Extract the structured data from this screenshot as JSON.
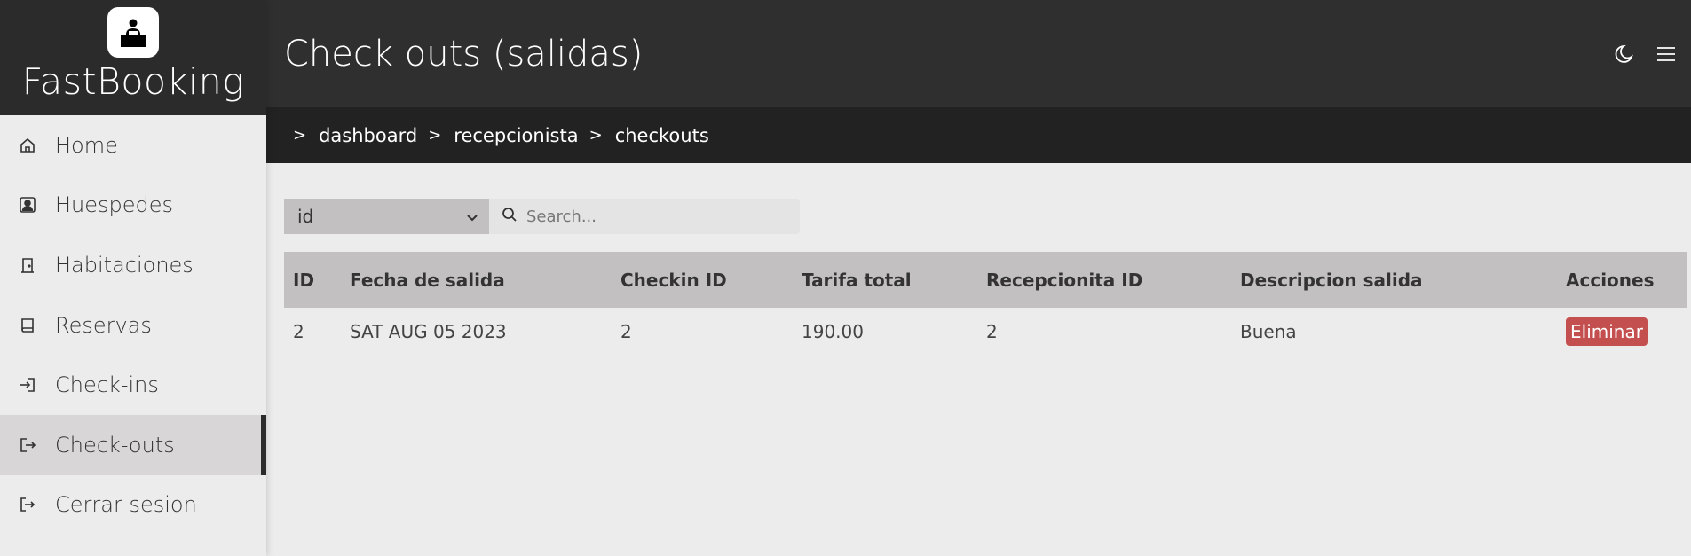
{
  "brand": {
    "name": "FastBooking"
  },
  "sidebar": {
    "items": [
      {
        "label": "Home",
        "icon": "home-icon"
      },
      {
        "label": "Huespedes",
        "icon": "guest-icon"
      },
      {
        "label": "Habitaciones",
        "icon": "door-icon"
      },
      {
        "label": "Reservas",
        "icon": "book-icon"
      },
      {
        "label": "Check-ins",
        "icon": "checkin-icon"
      },
      {
        "label": "Check-outs",
        "icon": "checkout-icon",
        "active": true
      },
      {
        "label": "Cerrar sesion",
        "icon": "logout-icon"
      }
    ]
  },
  "header": {
    "title": "Check outs (salidas)"
  },
  "breadcrumb": [
    "dashboard",
    "recepcionista",
    "checkouts"
  ],
  "filter": {
    "selected": "id",
    "search_placeholder": "Search..."
  },
  "table": {
    "columns": [
      "ID",
      "Fecha de salida",
      "Checkin ID",
      "Tarifa total",
      "Recepcionita ID",
      "Descripcion salida",
      "Acciones"
    ],
    "rows": [
      {
        "id": "2",
        "fecha": "SAT AUG 05 2023",
        "checkin_id": "2",
        "tarifa": "190.00",
        "recepcionista_id": "2",
        "descripcion": "Buena",
        "action": "Eliminar"
      }
    ]
  },
  "colors": {
    "header_bg": "#2f2f2f",
    "breadcrumb_bg": "#222222",
    "delete_button": "#c44f4f",
    "active_item": "#d8d6d6"
  }
}
